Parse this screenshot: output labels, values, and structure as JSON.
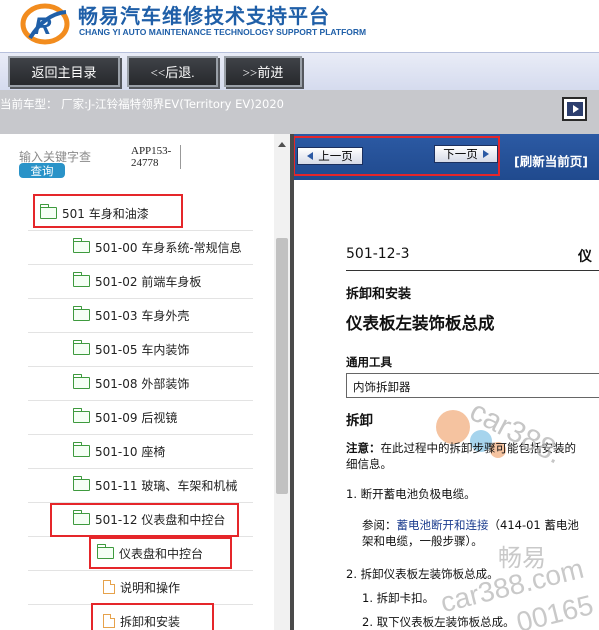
{
  "brand": {
    "title": "畅易汽车维修技术支持平台",
    "subtitle": "CHANG YI AUTO MAINTENANCE TECHNOLOGY SUPPORT PLATFORM",
    "logo_letter": "R",
    "colors": {
      "primary": "#1f5fa8",
      "logo_orange": "#f28c1e"
    }
  },
  "toolbar": {
    "back_main_label": "返回主目录",
    "prev_label": "<<后退.",
    "next_label": ">>前进"
  },
  "vehicle": {
    "text": "当前车型：  厂家:J-江铃福特领界EV(Territory EV)2020"
  },
  "search": {
    "hint": "输入关键字查",
    "query_label": "查询",
    "app_code_line1": "APP153-",
    "app_code_line2": "24778"
  },
  "tree": {
    "items": [
      {
        "label": "501 车身和油漆",
        "icon": "folder-icon"
      },
      {
        "label": "501-00 车身系统-常规信息",
        "icon": "folder-icon"
      },
      {
        "label": "501-02 前端车身板",
        "icon": "folder-icon"
      },
      {
        "label": "501-03 车身外壳",
        "icon": "folder-icon"
      },
      {
        "label": "501-05 车内装饰",
        "icon": "folder-icon"
      },
      {
        "label": "501-08 外部装饰",
        "icon": "folder-icon"
      },
      {
        "label": "501-09 后视镜",
        "icon": "folder-icon"
      },
      {
        "label": "501-10 座椅",
        "icon": "folder-icon"
      },
      {
        "label": "501-11 玻璃、车架和机械",
        "icon": "folder-icon"
      },
      {
        "label": "501-12 仪表盘和中控台",
        "icon": "folder-icon"
      },
      {
        "label": "仪表盘和中控台",
        "icon": "folder-icon"
      },
      {
        "label": "说明和操作",
        "icon": "document-icon"
      },
      {
        "label": "拆卸和安装",
        "icon": "document-icon"
      }
    ]
  },
  "pager": {
    "prev_label": "上一页",
    "next_label": "下一页",
    "refresh_label": "[刷新当前页]"
  },
  "document": {
    "code": "501-12-3",
    "code_right": "仪",
    "subtitle": "拆卸和安装",
    "title": "仪表板左装饰板总成",
    "tools_label": "通用工具",
    "tools_value": "内饰拆卸器",
    "section": "拆卸",
    "note_label": "注意：",
    "note_text": "在此过程中的拆卸步骤可能包括安装的",
    "note_text2": "细信息。",
    "step1": "1.  断开蓄电池负极电缆。",
    "ref_label": "参阅：",
    "ref_link": "蓄电池断开和连接",
    "ref_text": "（414-01 蓄电池",
    "ref_text2": "架和电缆，一般步骤）。",
    "step2": "2.  拆卸仪表板左装饰板总成。",
    "step2_1": "1.  拆卸卡扣。",
    "step2_2": "2.  取下仪表板左装饰板总成。"
  },
  "watermarks": {
    "car1": "car388.",
    "cn": "畅易",
    "car2": "car388.com",
    "num": "00165"
  }
}
